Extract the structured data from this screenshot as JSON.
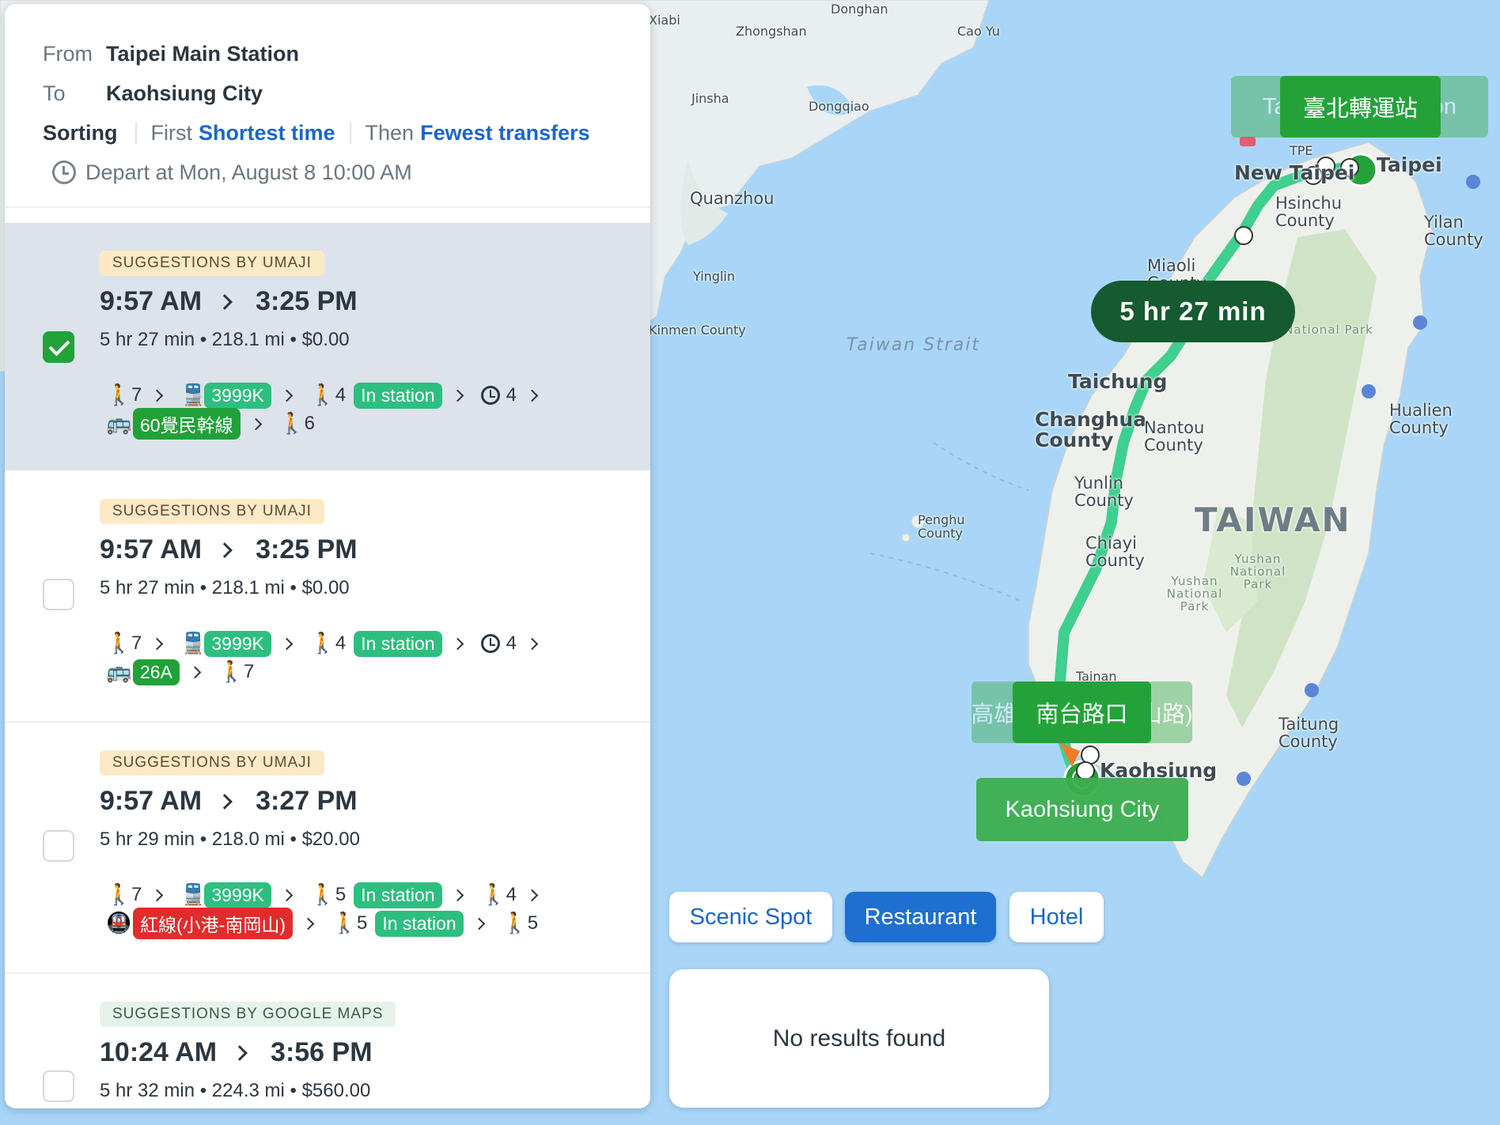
{
  "search": {
    "from_label": "From",
    "from_value": "Taipei Main Station",
    "to_label": "To",
    "to_value": "Kaohsiung City",
    "sorting_label": "Sorting",
    "first_label": "First",
    "first_value": "Shortest time",
    "then_label": "Then",
    "then_value": "Fewest transfers",
    "depart_text": "Depart at Mon, August 8 10:00 AM"
  },
  "routes": [
    {
      "source": "SUGGESTIONS BY UMAJI",
      "depart": "9:57 AM",
      "arrive": "3:25 PM",
      "meta": "5 hr 27 min • 218.1 mi • $0.00",
      "selected": true,
      "line1": {
        "walk1": "7",
        "train": "3999K",
        "walk2": "4",
        "instation": "In station",
        "wait": "4"
      },
      "line2": {
        "bus": "60覺民幹線",
        "walk": "6"
      }
    },
    {
      "source": "SUGGESTIONS BY UMAJI",
      "depart": "9:57 AM",
      "arrive": "3:25 PM",
      "meta": "5 hr 27 min • 218.1 mi • $0.00",
      "selected": false,
      "line1": {
        "walk1": "7",
        "train": "3999K",
        "walk2": "4",
        "instation": "In station",
        "wait": "4"
      },
      "line2": {
        "bus": "26A",
        "walk": "7"
      }
    },
    {
      "source": "SUGGESTIONS BY UMAJI",
      "depart": "9:57 AM",
      "arrive": "3:27 PM",
      "meta": "5 hr 29 min • 218.0 mi • $20.00",
      "selected": false,
      "line1": {
        "walk1": "7",
        "train": "3999K",
        "walk2": "5",
        "instation": "In station",
        "walk3": "4"
      },
      "line2": {
        "metro": "紅線(小港-南岡山)",
        "walk1": "5",
        "instation": "In station",
        "walk2": "5"
      }
    },
    {
      "source": "SUGGESTIONS BY GOOGLE MAPS",
      "depart": "10:24 AM",
      "arrive": "3:56 PM",
      "meta": "5 hr 32 min • 224.3 mi • $560.00",
      "selected": false
    }
  ],
  "map": {
    "duration": "5 hr 27 min",
    "start_label_ghost": "Taipei Main Station",
    "start_label": "臺北轉運站",
    "mid_label_ghost": "高雄(南台路口中山路)",
    "mid_label": "南台路口",
    "end_label": "Kaohsiung City",
    "places": {
      "donghan": "Donghan",
      "zhongshan": "Zhongshan",
      "cao_yu": "Cao Yu",
      "jinsha": "Jinsha",
      "dongqiao": "Dongqiao",
      "quanzhou": "Quanzhou",
      "yinglin": "Yinglin",
      "taiwan_strait": "Taiwan Strait",
      "new_taipei": "New Taipei",
      "taipei": "Taipei",
      "hsinchu": "Hsinchu County",
      "yilan": "Yilan County",
      "miaoli": "Miaoli County",
      "taichung": "Taichung",
      "changhua": "Changhua County",
      "nantou": "Nantou County",
      "hualien": "Hualien County",
      "yunlin": "Yunlin County",
      "taiwan": "TAIWAN",
      "penghu": "Penghu County",
      "chiayi": "Chiayi County",
      "yushan1": "Yushan National Park",
      "yushan2": "Yushan National Park",
      "taitung": "Taitung County",
      "kaohsiung": "Kaohsiung",
      "tainan": "Tainan",
      "shei_pa": "Shei-Pa National Park",
      "tpe": "TPE",
      "kinmen": "Kinmen County",
      "xiabi": "Xiabi"
    },
    "route_color": "#3fcf8e",
    "label_color": "#3cae4e"
  },
  "poi": {
    "buttons": [
      "Scenic Spot",
      "Restaurant",
      "Hotel"
    ],
    "active": "Restaurant",
    "no_results": "No results found"
  }
}
